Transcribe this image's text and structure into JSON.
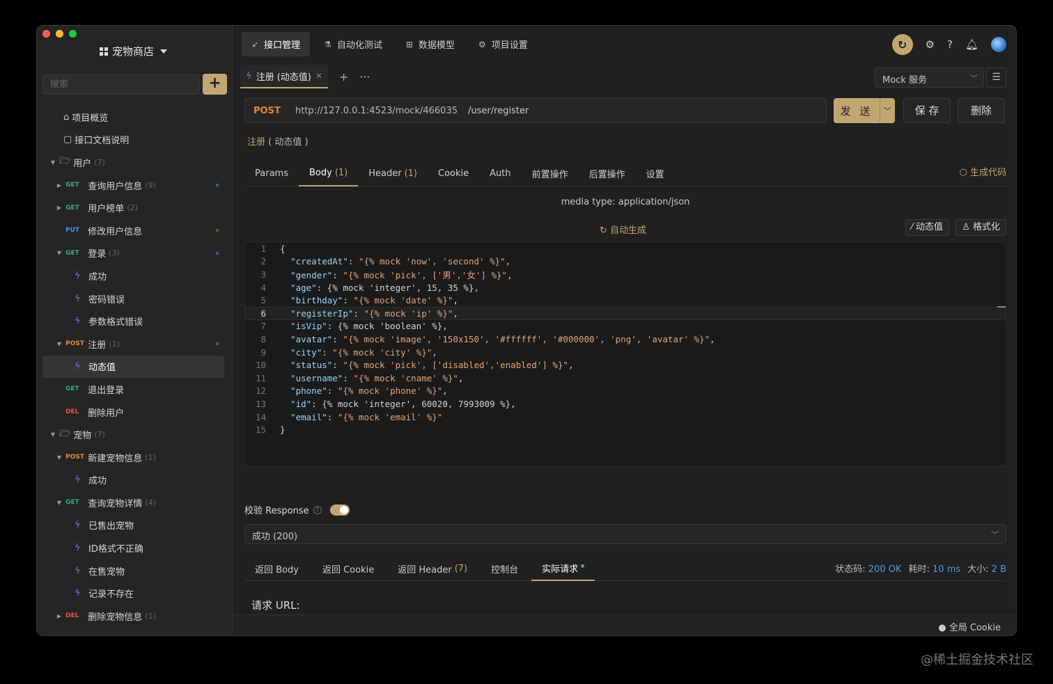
{
  "project": {
    "title": "宠物商店"
  },
  "search": {
    "placeholder": "搜索"
  },
  "add_label": "+",
  "tree": {
    "overview": "项目概览",
    "docs": "接口文档说明",
    "folder_user": {
      "label": "用户",
      "count": "(7)"
    },
    "user_query": {
      "method": "GET",
      "label": "查询用户信息",
      "count": "(9)"
    },
    "user_rank": {
      "method": "GET",
      "label": "用户榜单",
      "count": "(2)"
    },
    "user_edit": {
      "method": "PUT",
      "label": "修改用户信息"
    },
    "login": {
      "method": "GET",
      "label": "登录",
      "count": "(3)"
    },
    "login_cases": [
      "成功",
      "密码错误",
      "参数格式错误"
    ],
    "register": {
      "method": "POST",
      "label": "注册",
      "count": "(1)"
    },
    "register_case": "动态值",
    "logout": {
      "method": "GET",
      "label": "退出登录"
    },
    "del_user": {
      "method": "DEL",
      "label": "删除用户"
    },
    "folder_pet": {
      "label": "宠物",
      "count": "(7)"
    },
    "pet_new": {
      "method": "POST",
      "label": "新建宠物信息",
      "count": "(1)"
    },
    "pet_new_case": "成功",
    "pet_detail": {
      "method": "GET",
      "label": "查询宠物详情",
      "count": "(4)"
    },
    "pet_detail_cases": [
      "已售出宠物",
      "ID格式不正确",
      "在售宠物",
      "记录不存在"
    ],
    "pet_del": {
      "method": "DEL",
      "label": "删除宠物信息",
      "count": "(1)"
    }
  },
  "nav": {
    "tabs": [
      "接口管理",
      "自动化测试",
      "数据模型",
      "项目设置"
    ]
  },
  "request_tab": {
    "label": "注册 (动态值)"
  },
  "mock_service": "Mock 服务",
  "url": {
    "method": "POST",
    "base": "http://127.0.0.1:4523/mock/466035",
    "path": "/user/register"
  },
  "buttons": {
    "send": "发 送",
    "save": "保 存",
    "delete": "删除"
  },
  "request_name": {
    "main": "注册",
    "sub": "( 动态值 )"
  },
  "subtabs": {
    "params": "Params",
    "body": "Body",
    "body_count": "(1)",
    "header": "Header",
    "header_count": "(1)",
    "cookie": "Cookie",
    "auth": "Auth",
    "pre": "前置操作",
    "post": "后置操作",
    "settings": "设置"
  },
  "generate_code": "生成代码",
  "media_type": "media type: application/json",
  "auto_generate": "自动生成",
  "dynamic_value": "动态值",
  "format": "格式化",
  "code_lines": [
    "{",
    "  \"createdAt\": \"{% mock 'now', 'second' %}\",",
    "  \"gender\": \"{% mock 'pick', ['男','女'] %}\",",
    "  \"age\": {% mock 'integer', 15, 35 %},",
    "  \"birthday\": \"{% mock 'date' %}\",",
    "  \"registerIp\": \"{% mock 'ip' %}\",",
    "  \"isVip\": {% mock 'boolean' %},",
    "  \"avatar\": \"{% mock 'image', '150x150', '#ffffff', '#000000', 'png', 'avatar' %}\",",
    "  \"city\": \"{% mock 'city' %}\",",
    "  \"status\": \"{% mock 'pick', ['disabled','enabled'] %}\",",
    "  \"username\": \"{% mock 'cname' %}\",",
    "  \"phone\": \"{% mock 'phone' %}\",",
    "  \"id\": {% mock 'integer', 60020, 7993009 %},",
    "  \"email\": \"{% mock 'email' %}\"",
    "}"
  ],
  "validate": {
    "label": "校验 Response",
    "enabled": true
  },
  "response_select": "成功 (200)",
  "resptabs": {
    "body": "返回 Body",
    "cookie": "返回 Cookie",
    "header": "返回 Header",
    "header_count": "(7)",
    "console": "控制台",
    "actual": "实际请求"
  },
  "stats": {
    "status_label": "状态码:",
    "status_value": "200 OK",
    "time_label": "耗时:",
    "time_value": "10 ms",
    "size_label": "大小:",
    "size_value": "2 B"
  },
  "request_url_label": "请求 URL:",
  "global_cookie": "全局 Cookie",
  "watermark": "@稀土掘金技术社区"
}
